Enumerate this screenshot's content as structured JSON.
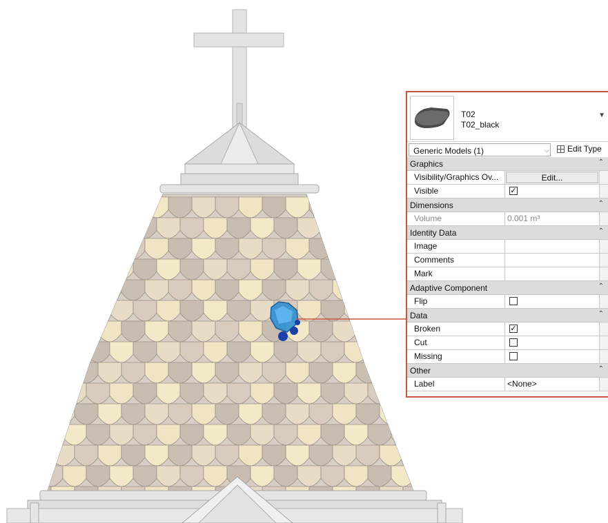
{
  "type_selector": {
    "family": "T02",
    "type": "T02_black"
  },
  "instance_filter": {
    "selected": "Generic Models (1)",
    "edit_type_label": "Edit Type"
  },
  "groups": {
    "graphics": "Graphics",
    "dimensions": "Dimensions",
    "identity": "Identity Data",
    "adaptive": "Adaptive Component",
    "data": "Data",
    "other": "Other"
  },
  "params": {
    "visibility_overrides": {
      "label": "Visibility/Graphics Ov...",
      "button": "Edit..."
    },
    "visible": {
      "label": "Visible",
      "checked": true
    },
    "volume": {
      "label": "Volume",
      "value": "0.001 m³"
    },
    "image": {
      "label": "Image",
      "value": ""
    },
    "comments": {
      "label": "Comments",
      "value": ""
    },
    "mark": {
      "label": "Mark",
      "value": ""
    },
    "flip": {
      "label": "Flip",
      "checked": false
    },
    "broken": {
      "label": "Broken",
      "checked": true
    },
    "cut": {
      "label": "Cut",
      "checked": false
    },
    "missing": {
      "label": "Missing",
      "checked": false
    },
    "label": {
      "label": "Label",
      "value": "<None>"
    }
  },
  "colors": {
    "highlight": "#2f8fd0",
    "callout": "#c8553d",
    "tile_light": "#f3e9c8",
    "tile_dark": "#cbbfb3"
  }
}
